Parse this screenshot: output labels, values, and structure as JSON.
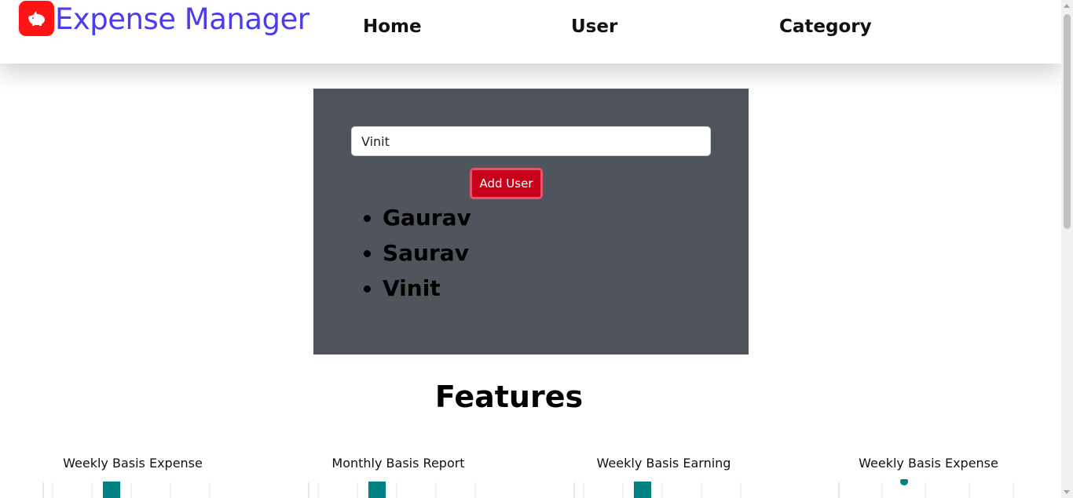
{
  "app": {
    "brand": "Expense Manager",
    "logo_icon": "piggy-bank-icon",
    "brand_color": "#4b3ded",
    "logo_color": "#ff1313"
  },
  "nav": {
    "items": [
      {
        "label": "Home"
      },
      {
        "label": "User"
      },
      {
        "label": "Category"
      }
    ]
  },
  "user_form": {
    "input_value": "Vinit",
    "button_label": "Add User",
    "button_color": "#c9001a"
  },
  "users": [
    "Gaurav",
    "Saurav",
    "Vinit"
  ],
  "features": {
    "title": "Features",
    "cards": [
      {
        "title": "Weekly Basis Expense",
        "chart": "bar"
      },
      {
        "title": "Monthly Basis Report",
        "chart": "bar"
      },
      {
        "title": "Weekly Basis Earning",
        "chart": "bar"
      },
      {
        "title": "Weekly Basis Expense",
        "chart": "scatter"
      }
    ],
    "accent_color": "#008080"
  }
}
